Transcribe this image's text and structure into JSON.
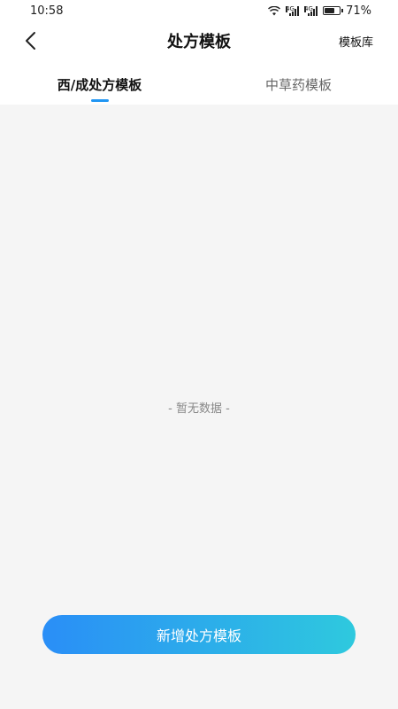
{
  "status_bar": {
    "time": "10:58",
    "network_1": "4G",
    "network_2": "4G",
    "battery": "71%"
  },
  "header": {
    "title": "处方模板",
    "right_link": "模板库",
    "back_icon": "chevron-left-icon"
  },
  "tabs": [
    {
      "label": "西/成处方模板",
      "active": true
    },
    {
      "label": "中草药模板",
      "active": false
    }
  ],
  "empty_state": {
    "text": "- 暂无数据 -"
  },
  "actions": {
    "add_button": "新增处方模板"
  },
  "colors": {
    "accent": "#2196f3",
    "button_gradient_start": "#2a8ef7",
    "button_gradient_end": "#2ec9de",
    "background": "#f5f5f5"
  }
}
